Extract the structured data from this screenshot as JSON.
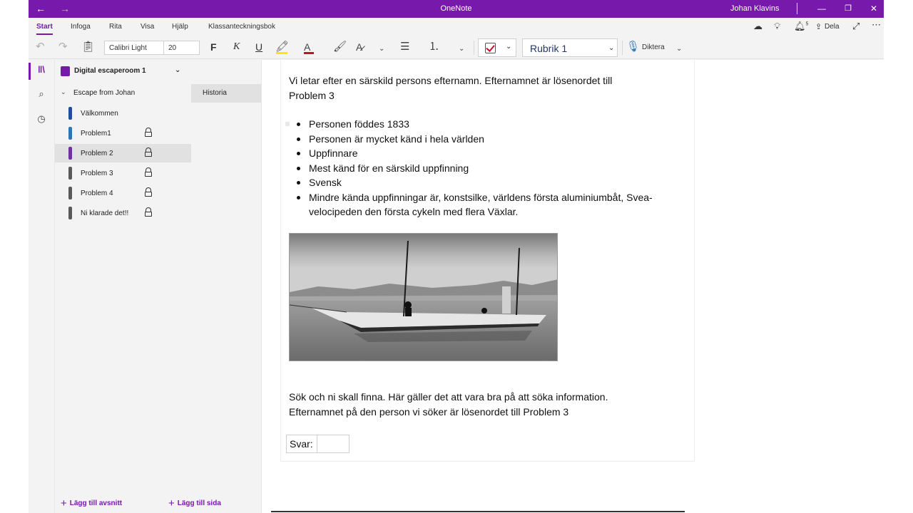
{
  "titlebar": {
    "back_glyph": "←",
    "forward_glyph": "→",
    "app_title": "OneNote",
    "user_name": "Johan Klavins",
    "minimize_glyph": "—",
    "restore_glyph": "❐",
    "close_glyph": "✕"
  },
  "ribbon": {
    "tabs": [
      "Start",
      "Infoga",
      "Rita",
      "Visa",
      "Hjälp",
      "Klassanteckningsbok"
    ],
    "active_tab": "Start",
    "share_label": "Dela",
    "notification_count": "5"
  },
  "toolbar": {
    "font_name": "Calibri Light",
    "font_size": "20",
    "bold_label": "F",
    "italic_label": "K",
    "underline_label": "U",
    "style_name": "Rubrik 1",
    "dictate_label": "Diktera",
    "accent_color": "#7719aa",
    "highlight_color": "#ffe600",
    "font_color": "#c8102e"
  },
  "sidebar": {
    "notebook_name": "Digital escaperoom 1",
    "section_group": "Escape from Johan",
    "section_tab": "Historia",
    "pages": [
      {
        "label": "Välkommen",
        "color": "#1f4e9c",
        "locked": false,
        "selected": false
      },
      {
        "label": "Problem1",
        "color": "#2e75b6",
        "locked": true,
        "selected": false
      },
      {
        "label": "Problem 2",
        "color": "#7030a0",
        "locked": true,
        "selected": true
      },
      {
        "label": "Problem 3",
        "color": "#595959",
        "locked": true,
        "selected": false
      },
      {
        "label": "Problem 4",
        "color": "#595959",
        "locked": true,
        "selected": false
      },
      {
        "label": "Ni klarade det!!",
        "color": "#595959",
        "locked": true,
        "selected": false
      }
    ],
    "add_section_label": "Lägg till avsnitt",
    "add_page_label": "Lägg till sida"
  },
  "page": {
    "intro_line1": "Vi letar efter en särskild persons efternamn. Efternamnet är lösenordet till",
    "intro_line2": "Problem 3",
    "bullets": [
      "Personen föddes 1833",
      "Personen är mycket känd i hela världen",
      "Uppfinnare",
      "Mest känd för en särskild uppfinning",
      "Svensk",
      "Mindre kända uppfinningar är, konstsilke, världens första aluminiumbåt, Svea-velocipeden den första cykeln med flera Växlar."
    ],
    "outro_line1": "Sök och ni skall finna. Här gäller det att vara bra på att söka information.",
    "outro_line2": "Efternamnet på den person vi söker är lösenordet till Problem 3",
    "answer_label": "Svar:",
    "answer_value": ""
  }
}
